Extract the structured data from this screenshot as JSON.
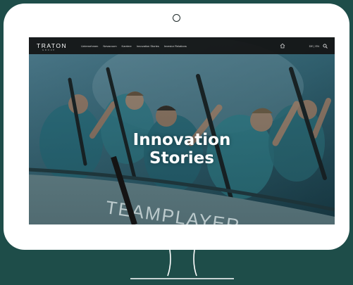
{
  "site": {
    "logo": "TRATON",
    "logo_sub": "GROUP",
    "nav_links": [
      "Unternehmen",
      "Newsroom",
      "Karriere",
      "Innovation Stories",
      "Investor Relations"
    ],
    "language": "DE | EN",
    "icons": {
      "home": "home-icon",
      "search": "search-icon"
    }
  },
  "hero": {
    "title_line1": "Innovation",
    "title_line2": "Stories",
    "boat_text": "TEAMPLAYER"
  },
  "colors": {
    "background": "#1e4d49",
    "monitor": "#ffffff",
    "nav_bar": "#141414"
  }
}
